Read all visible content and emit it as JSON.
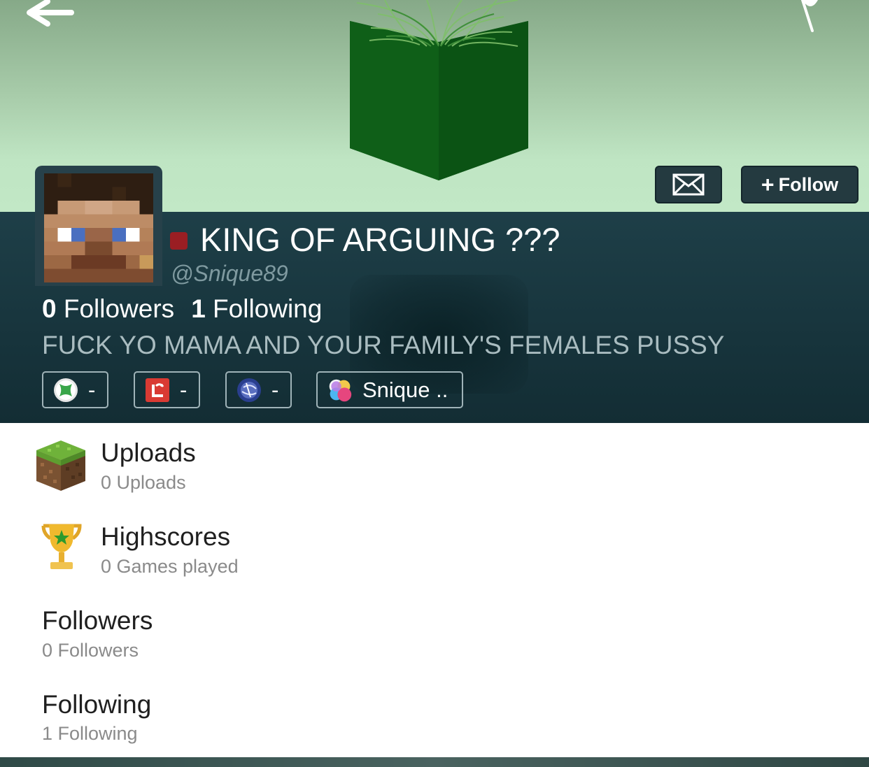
{
  "header": {
    "back_icon": "back-arrow-icon",
    "flag_icon": "report-flag-icon",
    "banner_colors": [
      "#86a988",
      "#c2e8c6"
    ]
  },
  "profile": {
    "display_name": "KING OF ARGUING ???",
    "username": "@Snique89",
    "status_color": "#9a1e23",
    "followers_count": "0",
    "followers_label": "Followers",
    "following_count": "1",
    "following_label": "Following",
    "bio": "FUCK YO MAMA AND YOUR FAMILY'S FEMALES PUSSY",
    "message_icon": "envelope-icon",
    "follow_label": "Follow",
    "follow_plus": "+"
  },
  "accounts": [
    {
      "icon": "xbox-icon",
      "value": "-"
    },
    {
      "icon": "red-app-icon",
      "value": "-"
    },
    {
      "icon": "playstation-icon",
      "value": "-"
    },
    {
      "icon": "game-center-icon",
      "value": "Snique .."
    }
  ],
  "menu": [
    {
      "title": "Uploads",
      "subtitle": "0 Uploads",
      "icon": "grass-block-icon"
    },
    {
      "title": "Highscores",
      "subtitle": "0 Games played",
      "icon": "trophy-icon"
    },
    {
      "title": "Followers",
      "subtitle": "0 Followers"
    },
    {
      "title": "Following",
      "subtitle": "1 Following"
    }
  ]
}
